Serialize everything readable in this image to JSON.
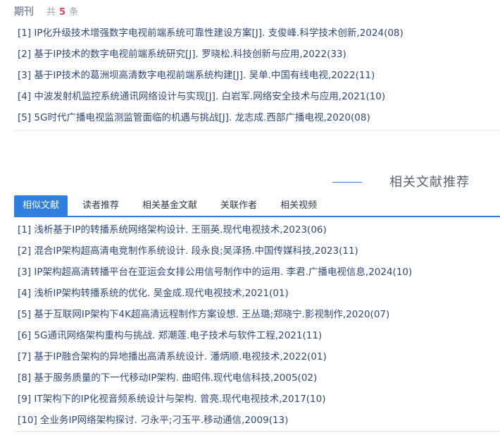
{
  "journal": {
    "title": "期刊",
    "count_prefix": "共",
    "count": "5",
    "count_suffix": "条",
    "items": [
      "[1] IP化升级技术增强数字电视前端系统可靠性建设方案[J]. 支俊峰.科学技术创新,2024(08)",
      "[2] 基于IP技术的数字电视前端系统研究[J]. 罗晓松.科技创新与应用,2022(33)",
      "[3] 基于IP技术的葛洲坝高清数字电视前端系统构建[J]. 吴单.中国有线电视,2022(11)",
      "[4] 中波发射机监控系统通讯网络设计与实现[J]. 白岩军.网络安全技术与应用,2021(10)",
      "[5] 5G时代广播电视监测监管面临的机遇与挑战[J]. 龙志成.西部广播电视,2020(08)"
    ]
  },
  "recommend": {
    "title": "相关文献推荐",
    "tabs": [
      "相似文献",
      "读者推荐",
      "相关基金文献",
      "关联作者",
      "相关视频"
    ],
    "items": [
      "[1] 浅析基于IP的转播系统网络架构设计. 王丽英.现代电视技术,2023(06)",
      "[2] 混合IP架构超高清电竞制作系统设计. 段永良;吴泽扬.中国传媒科技,2023(11)",
      "[3] IP架构超高清转播平台在亚运会女排公用信号制作中的运用. 李君.广播电视信息,2024(10)",
      "[4] 浅析IP架构转播系统的优化. 吴金成.现代电视技术,2021(01)",
      "[5] 基于互联网IP架构下4K超高清远程制作方案设想. 王丛璐;郑晓宁.影视制作,2020(07)",
      "[6] 5G通讯网络架构重构与挑战. 郑潮莲.电子技术与软件工程,2021(11)",
      "[7] 基于IP融合架构的异地播出高清系统设计. 潘炳顺.电视技术,2022(01)",
      "[8] 基于服务质量的下一代移动IP架构. 曲昭伟.现代电信科技,2005(02)",
      "[9] IT架构下的IP化视音频系统设计与架构. 曾亮.现代电视技术,2017(10)",
      "[10] 全业务IP网络架构探讨. 刁永平;刁玉平.移动通信,2009(13)"
    ]
  }
}
